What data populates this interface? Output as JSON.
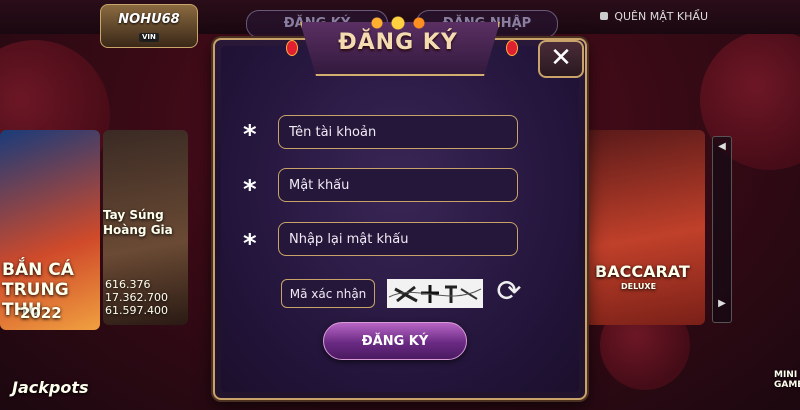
{
  "header": {
    "logo_text": "NOHU68",
    "logo_sub": "VIN",
    "tab_register": "ĐĂNG KÝ",
    "tab_login": "ĐĂNG NHẬP",
    "forgot_password": "QUÊN MẬT KHẨU"
  },
  "background_games": {
    "left_card_title": "BẮN CÁ TRUNG THU",
    "left_card_year": "2022",
    "second_card_title": "Tay Súng Hoàng Gia",
    "jackpot_1": "616.376",
    "jackpot_2": "17.362.700",
    "jackpot_3": "61.597.400",
    "right_card_title": "BACCARAT",
    "right_card_sub": "DELUXE",
    "jackpots_label": "Jackpots",
    "mini_game_label": "MINI GAME"
  },
  "dialog": {
    "title": "ĐĂNG KÝ",
    "fields": {
      "username_placeholder": "Tên tài khoản",
      "password_placeholder": "Mật khẩu",
      "confirm_placeholder": "Nhập lại mật khẩu",
      "captcha_placeholder": "Mã xác nhận"
    },
    "required_mark": "*",
    "close_label": "✕",
    "submit_label": "ĐĂNG KÝ"
  },
  "colors": {
    "accent_gold": "#c9a36a",
    "dialog_bg": "#22143a",
    "button_purple": "#6a2a84"
  }
}
